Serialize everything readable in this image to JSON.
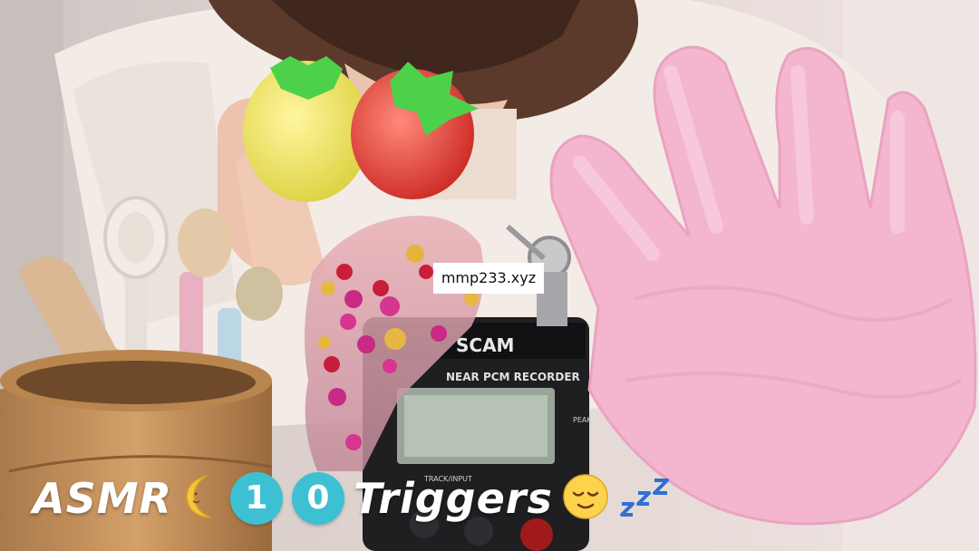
{
  "watermark": {
    "text": "mmp233.xyz"
  },
  "caption": {
    "word1": "ASMR",
    "digit1": "1",
    "digit2": "0",
    "word2": "Triggers"
  },
  "recorder": {
    "brand": "SCAM",
    "model": "NEAR PCM RECORDER",
    "peak": "PEAK",
    "track": "TRACK/INPUT"
  },
  "icons": [
    "crescent-moon-icon",
    "relieved-face-icon",
    "zzz-icon"
  ],
  "colors": {
    "badge": "#3ec0d3",
    "glove": "#f4b5cf",
    "caption": "#ffffff"
  }
}
